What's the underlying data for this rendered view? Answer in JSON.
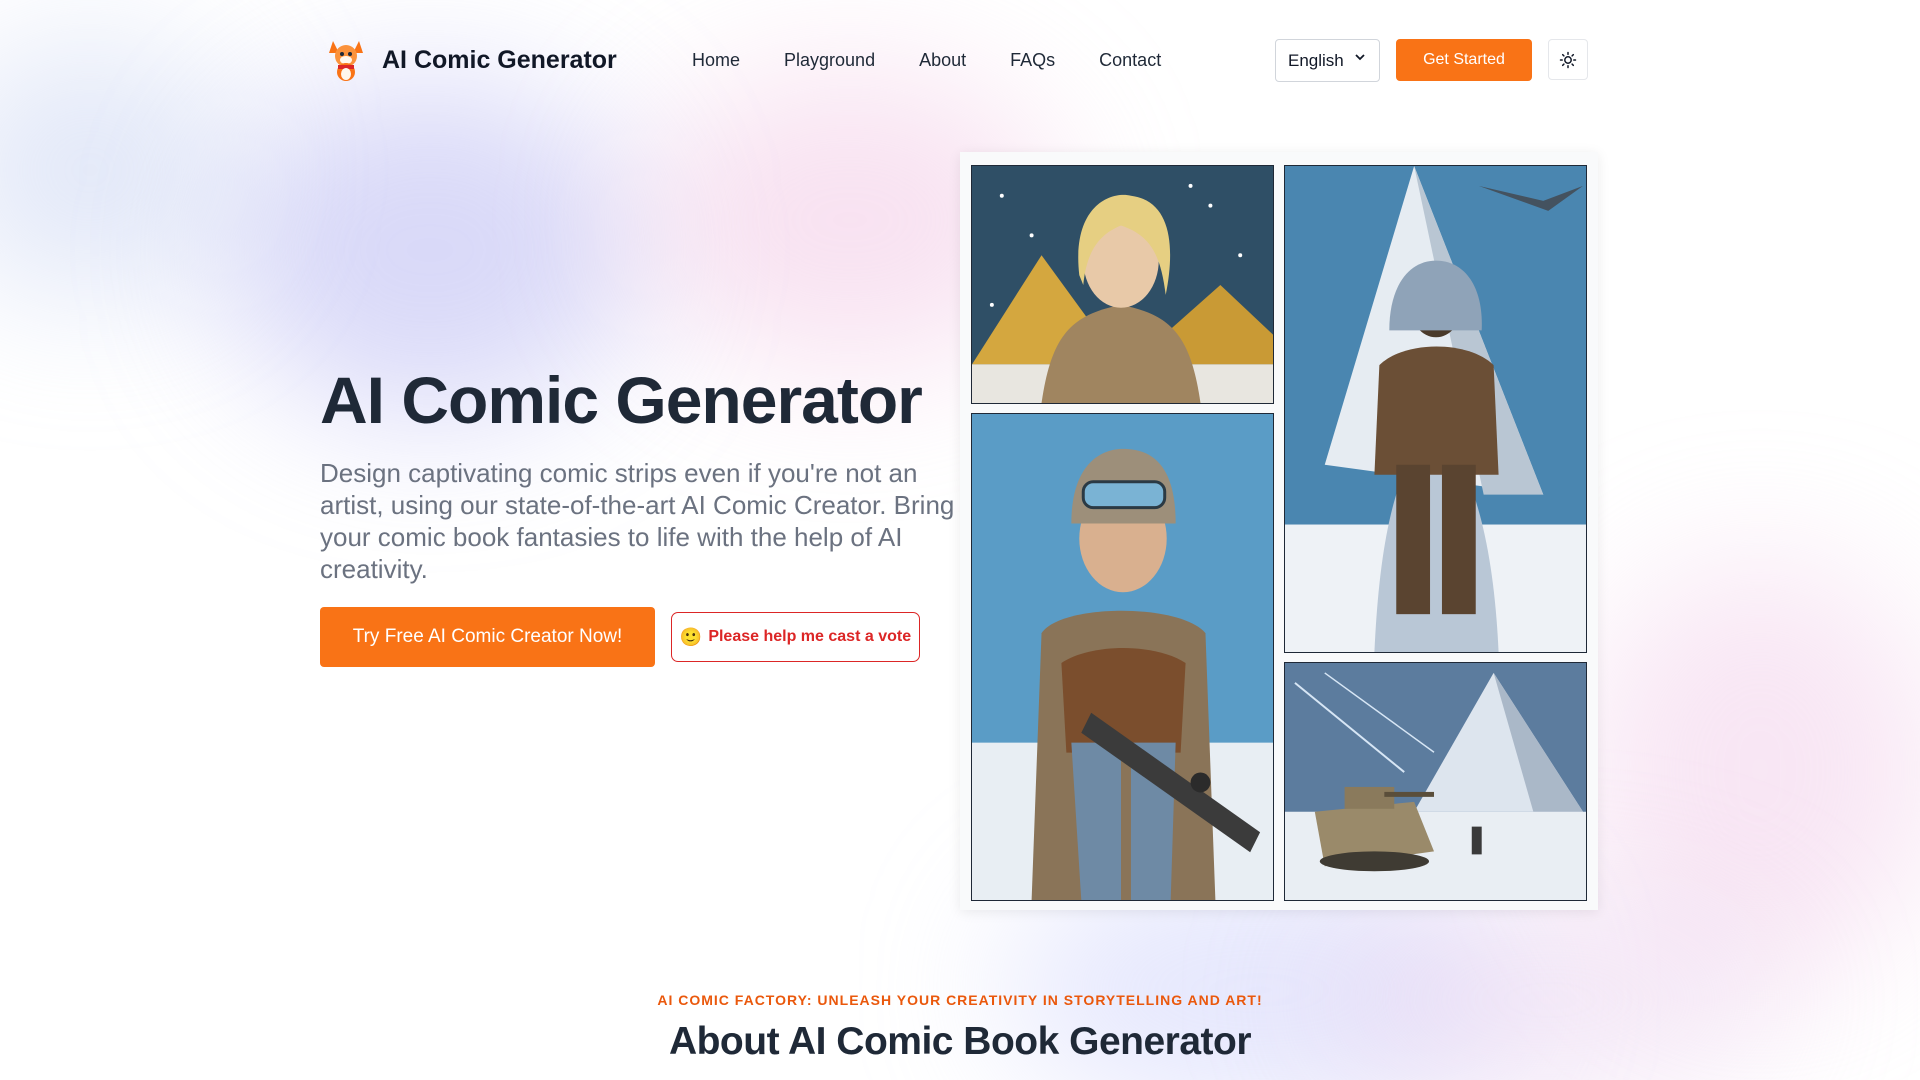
{
  "header": {
    "brand_name": "AI Comic Generator",
    "logo_icon": "fox-mascot-icon",
    "nav": [
      {
        "label": "Home"
      },
      {
        "label": "Playground"
      },
      {
        "label": "About"
      },
      {
        "label": "FAQs"
      },
      {
        "label": "Contact"
      }
    ],
    "language": {
      "selected": "English"
    },
    "get_started_label": "Get Started",
    "theme_icon": "sun-icon"
  },
  "hero": {
    "title": "AI Comic Generator",
    "subtitle": "Design captivating comic strips even if you're not an artist, using our state-of-the-art AI Comic Creator. Bring your comic book fantasies to life with the help of AI creativity.",
    "cta_label": "Try Free AI Comic Creator Now!",
    "vote_label": "Please help me cast a vote",
    "vote_emoji": "🙂"
  },
  "comic_panels": [
    {
      "icon": "blonde-woman-pyramids-panel"
    },
    {
      "icon": "hooded-warrior-snow-pyramid-panel"
    },
    {
      "icon": "soldier-with-rifle-panel"
    },
    {
      "icon": "tank-near-pyramid-panel"
    }
  ],
  "about": {
    "eyebrow": "AI COMIC FACTORY: UNLEASH YOUR CREATIVITY IN STORYTELLING AND ART!",
    "title": "About AI Comic Book Generator"
  },
  "colors": {
    "accent": "#f97316",
    "vote": "#dc2626",
    "text": "#1f2937",
    "muted": "#6b7280"
  }
}
